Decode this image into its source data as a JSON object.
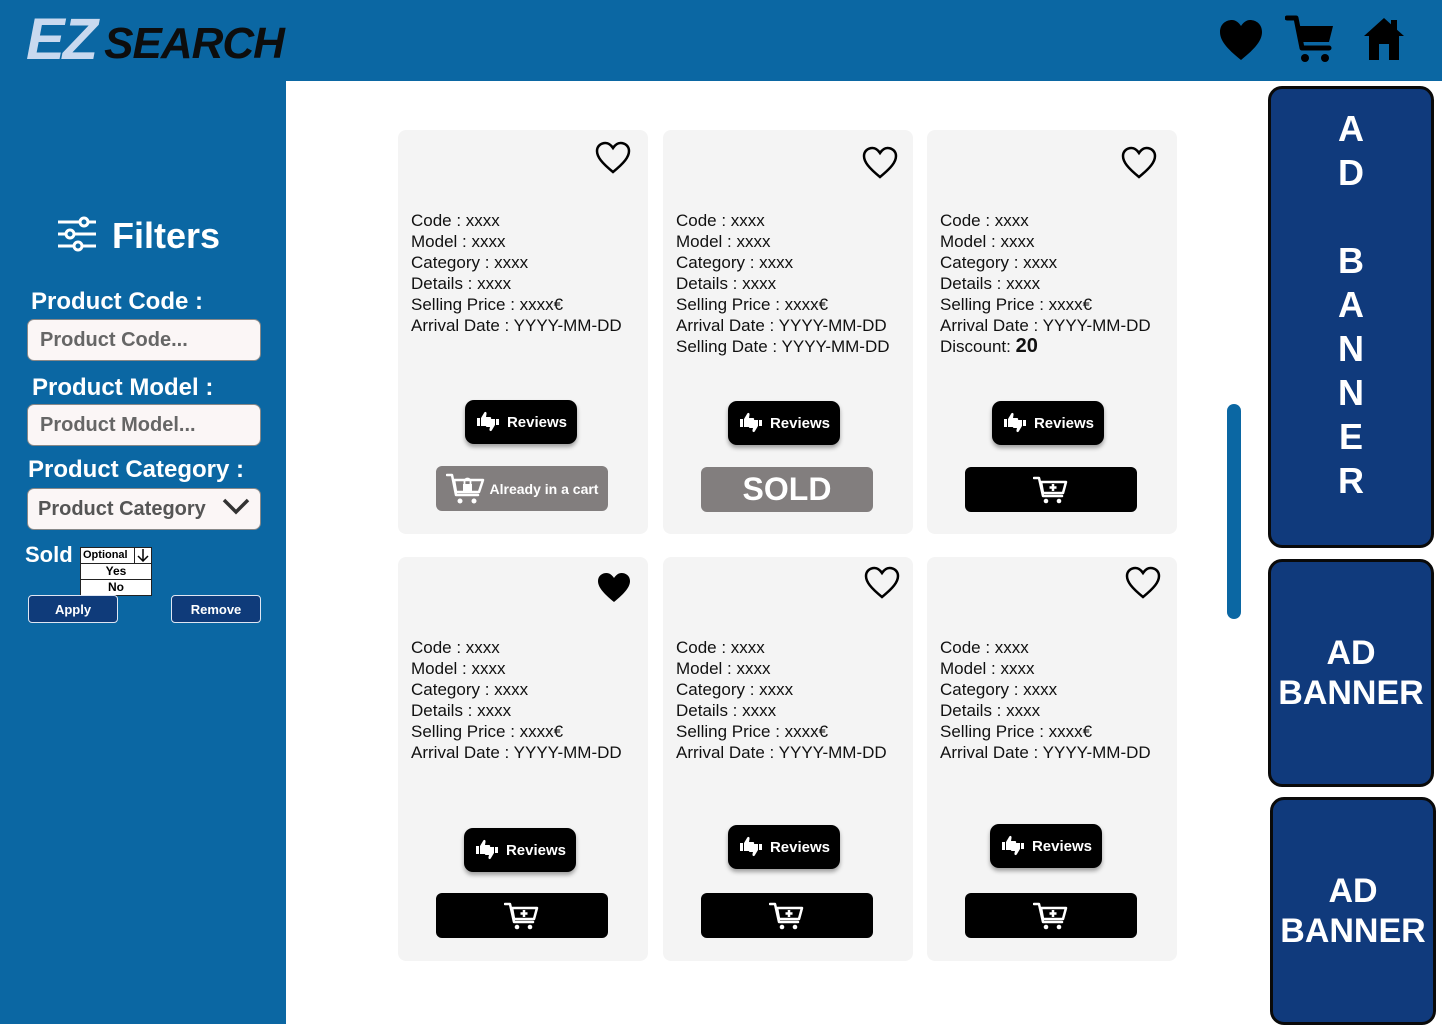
{
  "header": {
    "logo_ez": "EZ",
    "logo_search": "SEARCH",
    "icons": [
      "heart-icon",
      "cart-icon",
      "home-icon"
    ]
  },
  "sidebar": {
    "filters_title": "Filters",
    "product_code_label": "Product Code :",
    "product_code_placeholder": "Product Code...",
    "product_model_label": "Product Model :",
    "product_model_placeholder": "Product Model...",
    "product_category_label": "Product Category :",
    "product_category_value": "Product Category",
    "sold_label": "Sold",
    "sold_selected": "Optional",
    "sold_options": [
      "Yes",
      "No"
    ],
    "apply_label": "Apply",
    "remove_label": "Remove"
  },
  "products": [
    {
      "favorite": false,
      "lines": [
        "Code : xxxx",
        "Model : xxxx",
        "Category : xxxx",
        "Details : xxxx",
        "Selling Price : xxxx€",
        "Arrival Date : YYYY-MM-DD"
      ],
      "reviews_label": "Reviews",
      "action": "in-cart",
      "action_label": "Already in a cart"
    },
    {
      "favorite": false,
      "lines": [
        "Code : xxxx",
        "Model : xxxx",
        "Category : xxxx",
        "Details : xxxx",
        "Selling Price : xxxx€",
        "Arrival Date : YYYY-MM-DD",
        "Selling Date : YYYY-MM-DD"
      ],
      "reviews_label": "Reviews",
      "action": "sold",
      "action_label": "SOLD"
    },
    {
      "favorite": false,
      "lines": [
        "Code : xxxx",
        "Model : xxxx",
        "Category : xxxx",
        "Details : xxxx",
        "Selling Price : xxxx€",
        "Arrival Date : YYYY-MM-DD"
      ],
      "discount_label": "Discount:",
      "discount_value": "20",
      "reviews_label": "Reviews",
      "action": "add-to-cart"
    },
    {
      "favorite": true,
      "lines": [
        "Code : xxxx",
        "Model : xxxx",
        "Category : xxxx",
        "Details : xxxx",
        "Selling Price : xxxx€",
        "Arrival Date : YYYY-MM-DD"
      ],
      "reviews_label": "Reviews",
      "action": "add-to-cart"
    },
    {
      "favorite": false,
      "lines": [
        "Code : xxxx",
        "Model : xxxx",
        "Category : xxxx",
        "Details : xxxx",
        "Selling Price : xxxx€",
        "Arrival Date : YYYY-MM-DD"
      ],
      "reviews_label": "Reviews",
      "action": "add-to-cart"
    },
    {
      "favorite": false,
      "lines": [
        "Code : xxxx",
        "Model : xxxx",
        "Category : xxxx",
        "Details : xxxx",
        "Selling Price : xxxx€",
        "Arrival Date : YYYY-MM-DD"
      ],
      "reviews_label": "Reviews",
      "action": "add-to-cart"
    }
  ],
  "ads": {
    "vertical_letters": [
      "A",
      "D",
      "",
      "B",
      "A",
      "N",
      "N",
      "E",
      "R"
    ],
    "banner_2_line1": "AD",
    "banner_2_line2": "BANNER",
    "banner_3_line1": "AD",
    "banner_3_line2": "BANNER"
  },
  "colors": {
    "primary_blue": "#0b67a3",
    "ad_blue": "#103a7c",
    "sold_gray": "#827e7e",
    "card_bg": "#f4f4f4"
  }
}
